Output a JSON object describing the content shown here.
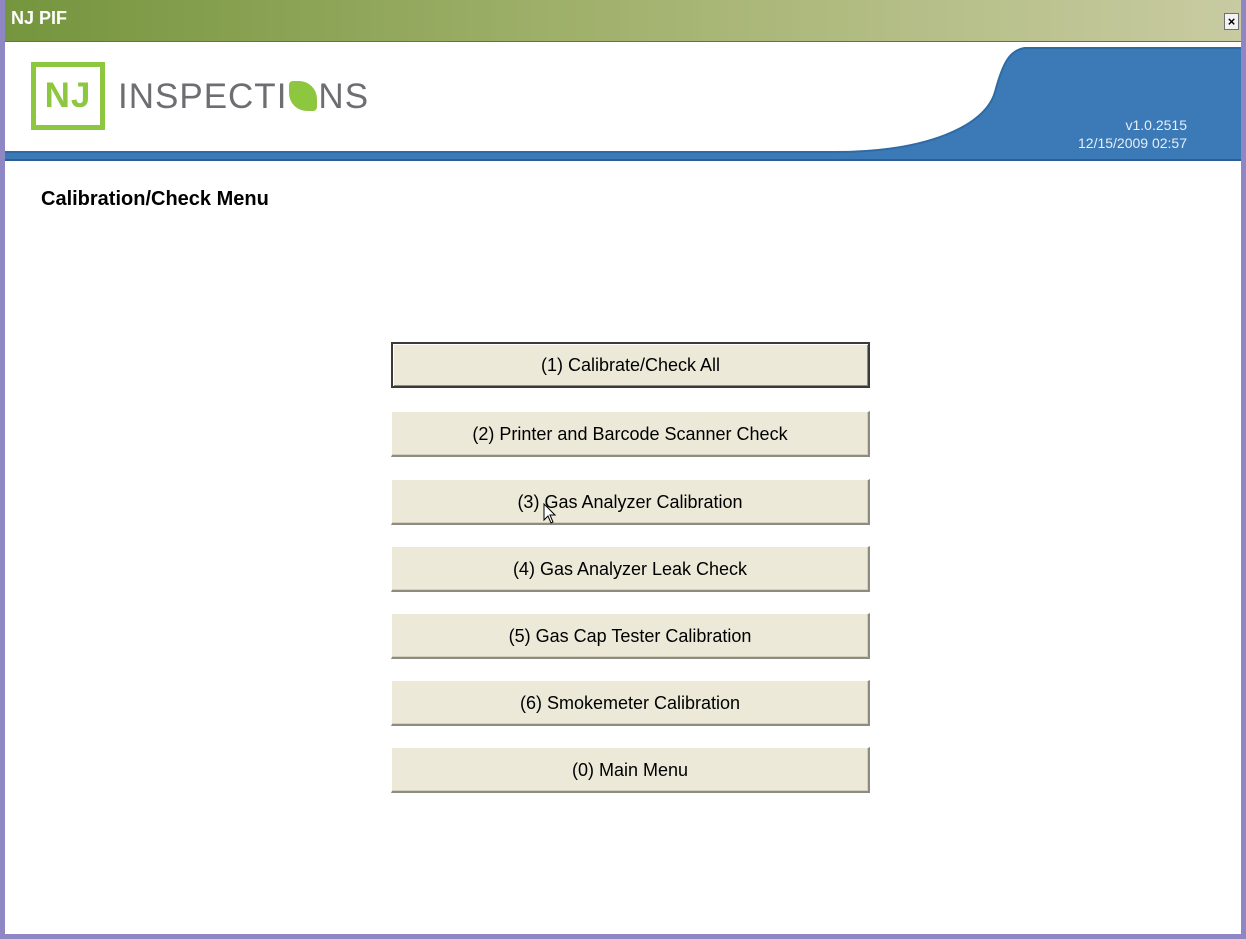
{
  "window": {
    "title": "NJ PIF",
    "close_label": "×"
  },
  "header": {
    "logo_short": "NJ",
    "logo_word_before": "INSPECTI",
    "logo_word_after": "NS",
    "version": "v1.0.2515",
    "datetime": "12/15/2009 02:57",
    "colors": {
      "logo_green": "#8dc63f",
      "band_blue": "#3b7ab6",
      "text_gray": "#6d6e71"
    }
  },
  "page": {
    "title": "Calibration/Check Menu"
  },
  "menu": {
    "items": [
      {
        "label": "(1) Calibrate/Check All"
      },
      {
        "label": "(2) Printer and Barcode Scanner Check"
      },
      {
        "label": "(3) Gas Analyzer Calibration"
      },
      {
        "label": "(4) Gas Analyzer Leak Check"
      },
      {
        "label": "(5) Gas Cap Tester Calibration"
      },
      {
        "label": "(6) Smokemeter Calibration"
      },
      {
        "label": "(0) Main Menu"
      }
    ]
  }
}
